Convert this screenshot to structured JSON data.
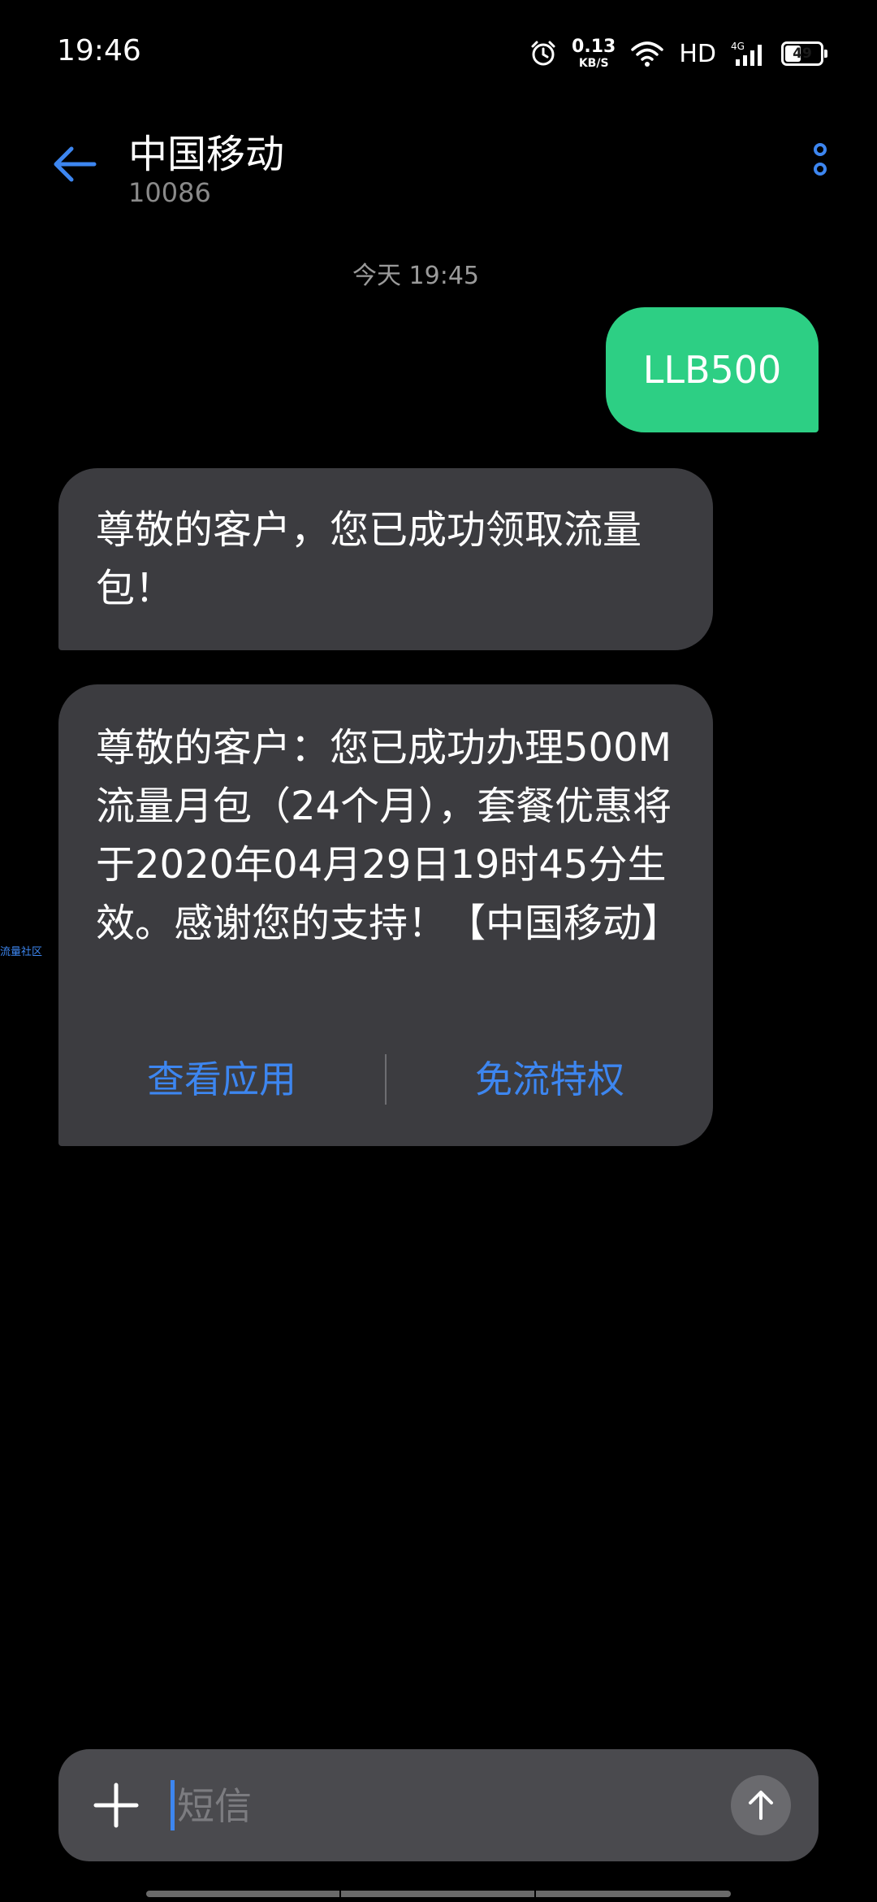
{
  "status_bar": {
    "time": "19:46",
    "net_speed_value": "0.13",
    "net_speed_unit": "KB/S",
    "hd_label": "HD",
    "network_type": "4G",
    "battery_level": "49",
    "battery_percent": 49
  },
  "header": {
    "contact_name": "中国移动",
    "contact_number": "10086"
  },
  "conversation": {
    "date_separator": "今天 19:45",
    "outgoing": [
      {
        "text": "LLB500"
      }
    ],
    "incoming": [
      {
        "text": "尊敬的客户，您已成功领取流量包！"
      },
      {
        "text": "尊敬的客户：您已成功办理500M流量月包（24个月），套餐优惠将于2020年04月29日19时45分生效。感谢您的支持！【中国移动】",
        "actions": [
          "查看应用",
          "免流特权"
        ]
      }
    ]
  },
  "side_tag": "流量社区",
  "composer": {
    "placeholder": "短信",
    "value": ""
  },
  "colors": {
    "outgoing_bubble": "#2dcf84",
    "incoming_bubble": "#3c3c40",
    "accent": "#3d86f0",
    "background": "#000000"
  }
}
